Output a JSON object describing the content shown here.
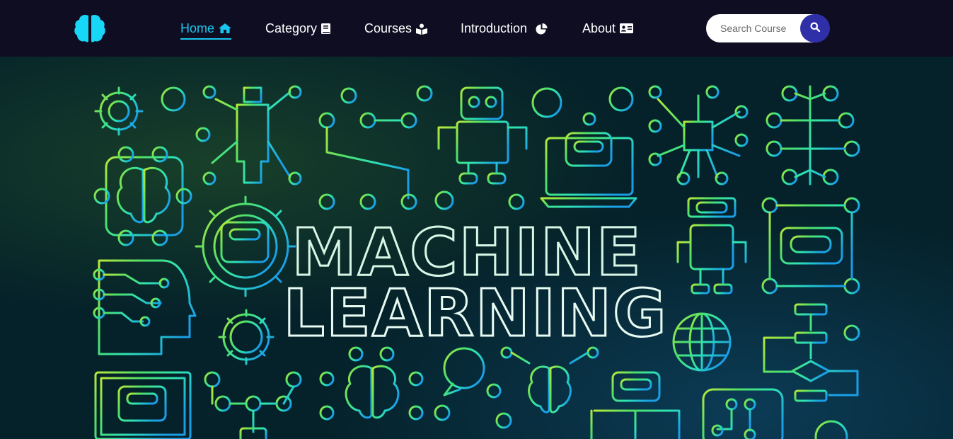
{
  "nav": {
    "items": [
      {
        "label": "Home",
        "icon": "home-icon",
        "active": true
      },
      {
        "label": "Category",
        "icon": "book-icon",
        "active": false
      },
      {
        "label": "Courses",
        "icon": "book-reader-icon",
        "active": false
      },
      {
        "label": "Introduction",
        "icon": "pie-chart-icon",
        "active": false
      },
      {
        "label": "About",
        "icon": "id-card-icon",
        "active": false
      }
    ],
    "search": {
      "placeholder": "Search Course"
    }
  },
  "colors": {
    "nav_bg": "#0f0d22",
    "accent": "#18c7ef",
    "search_button": "#2f2fa8",
    "hero_bg": "#05222a",
    "art_green": "#a6e22e",
    "art_teal": "#2ee6a8",
    "art_blue": "#1aa3e8"
  },
  "hero": {
    "line1": "MACHINE",
    "line2": "LEARNING"
  }
}
